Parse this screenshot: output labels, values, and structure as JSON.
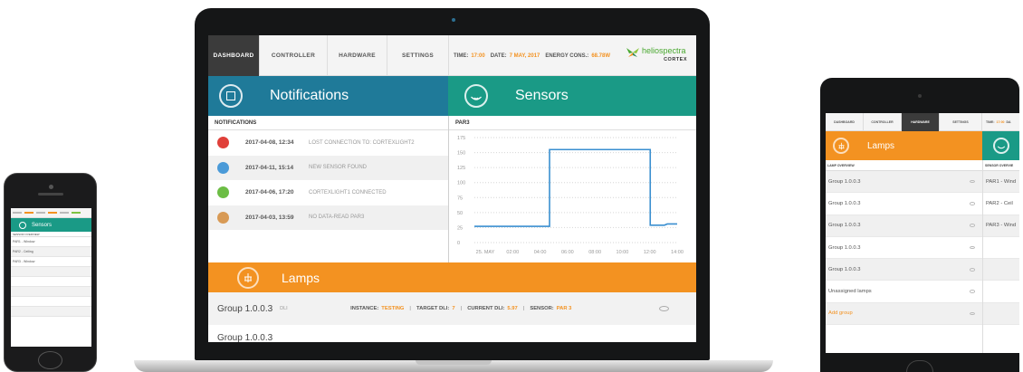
{
  "laptop": {
    "tabs": [
      {
        "label": "DASHBOARD",
        "active": true
      },
      {
        "label": "CONTROLLER",
        "active": false
      },
      {
        "label": "HARDWARE",
        "active": false
      },
      {
        "label": "SETTINGS",
        "active": false
      }
    ],
    "info": {
      "time_label": "TIME:",
      "time_value": "17:00",
      "date_label": "DATE:",
      "date_value": "7 MAY, 2017",
      "energy_label": "ENERGY CONS.:",
      "energy_value": "68.78W"
    },
    "brand": {
      "name": "heliospectra",
      "sub": "CORTEX"
    },
    "notifications": {
      "title": "Notifications",
      "subheader": "NOTIFICATIONS",
      "items": [
        {
          "date": "2017-04-08, 12:34",
          "message": "LOST CONNECTION TO: CORTEXLIGHT2",
          "color": "#e0403a"
        },
        {
          "date": "2017-04-11, 15:14",
          "message": "NEW SENSOR FOUND",
          "color": "#4a9ad8"
        },
        {
          "date": "2017-04-06, 17:20",
          "message": "CORTEXLIGHT1 CONNECTED",
          "color": "#6cbd45"
        },
        {
          "date": "2017-04-03, 13:59",
          "message": "NO DATA-READ PAR3",
          "color": "#d89a55"
        }
      ]
    },
    "sensors": {
      "title": "Sensors",
      "subheader": "PAR3"
    },
    "lamps": {
      "title": "Lamps",
      "row": {
        "name": "Group 1.0.0.3",
        "dli": "DLI",
        "instance_label": "INSTANCE:",
        "instance_value": "TESTING",
        "sep1": "|",
        "target_label": "TARGET DLI:",
        "target_value": "7",
        "sep2": "|",
        "current_label": "CURRENT DLI:",
        "current_value": "5.97",
        "sep3": "|",
        "sensor_label": "SENSOR:",
        "sensor_value": "PAR 3"
      },
      "row2_name": "Group 1.0.0.3"
    }
  },
  "chart_data": {
    "type": "line",
    "title": "PAR3",
    "xlabel": "",
    "ylabel": "",
    "x_ticks": [
      "25. MAY",
      "02:00",
      "04:00",
      "06:00",
      "08:00",
      "10:00",
      "12:00",
      "14:00"
    ],
    "y_ticks": [
      0,
      25,
      50,
      75,
      100,
      125,
      150,
      175
    ],
    "ylim": [
      0,
      175
    ],
    "series": [
      {
        "name": "",
        "color": "#3a8fd0",
        "points": [
          [
            0,
            27
          ],
          [
            5.3,
            27
          ],
          [
            5.3,
            155
          ],
          [
            12.4,
            155
          ],
          [
            12.4,
            29
          ],
          [
            13.4,
            29
          ],
          [
            13.6,
            31
          ],
          [
            14.3,
            31
          ]
        ]
      }
    ],
    "xlim": [
      0,
      14.3
    ],
    "grid": "horizontal dotted"
  },
  "phone": {
    "header": "Sensors",
    "subheader": "SENSOR OVERVIEW",
    "rows": [
      "PAR1 - Window",
      "PAR2 - Ceiling",
      "PAR3 - Window",
      "",
      "",
      "",
      "",
      ""
    ]
  },
  "tablet": {
    "tabs": [
      {
        "label": "DASHBOARD",
        "active": false
      },
      {
        "label": "CONTROLLER",
        "active": false
      },
      {
        "label": "HARDWARE",
        "active": true
      },
      {
        "label": "SETTINGS",
        "active": false
      }
    ],
    "info": {
      "time_label": "TIME:",
      "time_value": "17:00",
      "date_label": "DA"
    },
    "lamps": {
      "title": "Lamps",
      "subheader": "LAMP OVERVIEW",
      "rows": [
        {
          "label": "Group 1.0.0.3",
          "accent": false
        },
        {
          "label": "Group 1.0.0.3",
          "accent": false
        },
        {
          "label": "Group 1.0.0.3",
          "accent": false
        },
        {
          "label": "Group 1.0.0.3",
          "accent": false
        },
        {
          "label": "Group 1.0.0.3",
          "accent": false
        },
        {
          "label": "Unassigned lamps",
          "accent": false
        },
        {
          "label": "Add group",
          "accent": true
        }
      ]
    },
    "sensors": {
      "subheader": "SENSOR OVERVIE",
      "rows": [
        "PAR1 - Wind",
        "PAR2 - Ceil",
        "PAR3 - Wind",
        "",
        "",
        "",
        ""
      ]
    }
  }
}
